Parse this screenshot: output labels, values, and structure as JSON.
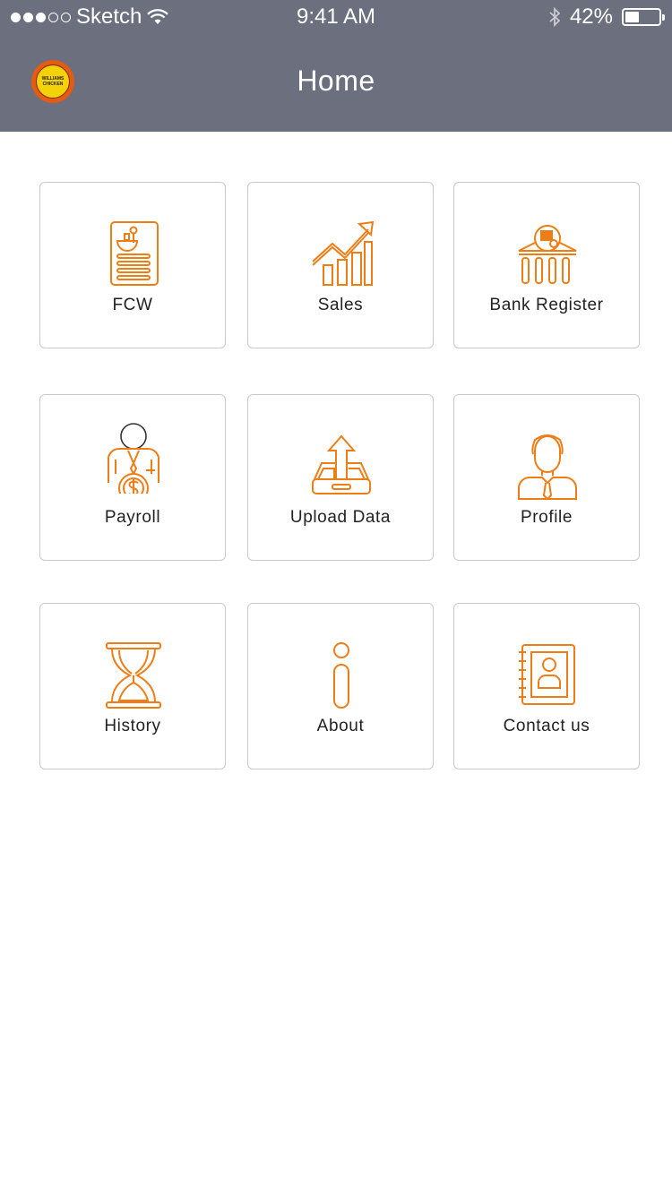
{
  "status_bar": {
    "carrier": "Sketch",
    "time": "9:41 AM",
    "battery_percent": "42%",
    "battery_level": 0.42,
    "signal_bars_filled": 3,
    "signal_bars_total": 5
  },
  "header": {
    "title": "Home",
    "logo_text": [
      "WILLIAMS",
      "CHICKEN"
    ]
  },
  "theme": {
    "header_bg": "#6b6f7e",
    "icon_color": "#ef7d16",
    "tile_border": "#c9c9c9"
  },
  "tiles": [
    {
      "label": "FCW",
      "icon": "menu-card-icon"
    },
    {
      "label": "Sales",
      "icon": "sales-chart-icon"
    },
    {
      "label": "Bank Register",
      "icon": "bank-icon"
    },
    {
      "label": "Payroll",
      "icon": "payroll-icon"
    },
    {
      "label": "Upload Data",
      "icon": "upload-tray-icon"
    },
    {
      "label": "Profile",
      "icon": "user-profile-icon"
    },
    {
      "label": "History",
      "icon": "hourglass-icon"
    },
    {
      "label": "About",
      "icon": "info-icon"
    },
    {
      "label": "Contact us",
      "icon": "contact-book-icon"
    }
  ]
}
